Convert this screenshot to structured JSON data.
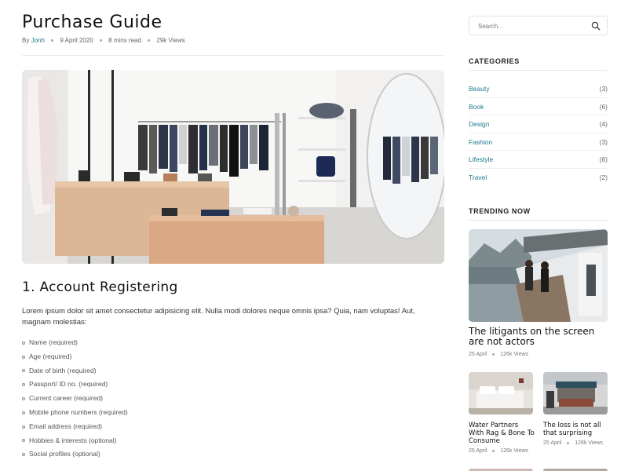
{
  "article": {
    "title": "Purchase Guide",
    "meta": {
      "by_label": "By",
      "author": "Jonh",
      "date": "9 April 2020",
      "read_time": "8 mins read",
      "views": "29k Views"
    },
    "section_heading": "1. Account Registering",
    "lead": "Lorem ipsum dolor sit amet consectetur adipisicing elit. Nulla modi dolores neque omnis ipsa? Quia, nam voluptas! Aut, magnam molestias:",
    "requirements": [
      "Name (required)",
      "Age (required)",
      "Date of birth (required)",
      "Passport/ ID no. (required)",
      "Current career (required)",
      "Mobile phone numbers (required)",
      "Email address (required)",
      "Hobbies & interests (optional)",
      "Social profiles (optional)"
    ]
  },
  "sidebar": {
    "search": {
      "placeholder": "Search...",
      "icon": "search-icon"
    },
    "categories_title": "CATEGORIES",
    "categories": [
      {
        "name": "Beauty",
        "count": "(3)"
      },
      {
        "name": "Book",
        "count": "(6)"
      },
      {
        "name": "Design",
        "count": "(4)"
      },
      {
        "name": "Fashion",
        "count": "(3)"
      },
      {
        "name": "Lifestyle",
        "count": "(6)"
      },
      {
        "name": "Travel",
        "count": "(2)"
      }
    ],
    "trending_title": "TRENDING NOW",
    "featured": {
      "title": "The litigants on the screen are not actors",
      "date": "25 April",
      "views": "126k Views"
    },
    "cards": [
      {
        "title": "Water Partners With Rag & Bone To Consume",
        "date": "25 April",
        "views": "126k Views"
      },
      {
        "title": "The loss is not all that surprising",
        "date": "25 April",
        "views": "126k Views"
      }
    ]
  },
  "colors": {
    "accent": "#1e7a8c",
    "text": "#222222",
    "muted": "#666666"
  }
}
